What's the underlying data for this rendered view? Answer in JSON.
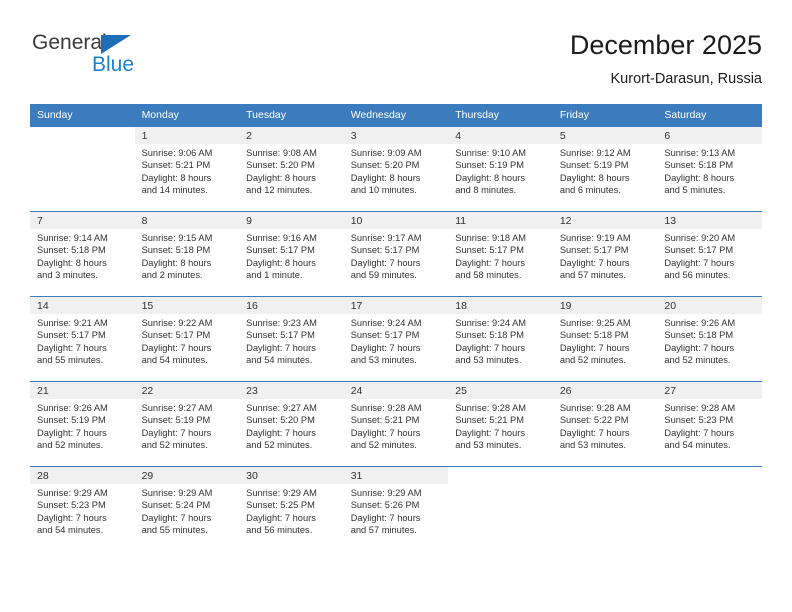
{
  "brand": {
    "name_part1": "General",
    "name_part2": "Blue",
    "triangle_color": "#1f6fb8",
    "blue_color": "#1f7fd0"
  },
  "header": {
    "title": "December 2025",
    "subtitle": "Kurort-Darasun, Russia"
  },
  "theme": {
    "header_bg": "#3b7cbf",
    "daynum_bg": "#f0f0f0",
    "row_border": "#3b7cbf"
  },
  "weekday_headers": [
    "Sunday",
    "Monday",
    "Tuesday",
    "Wednesday",
    "Thursday",
    "Friday",
    "Saturday"
  ],
  "weeks": [
    [
      {
        "day": "",
        "sunrise": "",
        "sunset": "",
        "daylight_line1": "",
        "daylight_line2": ""
      },
      {
        "day": "1",
        "sunrise": "Sunrise: 9:06 AM",
        "sunset": "Sunset: 5:21 PM",
        "daylight_line1": "Daylight: 8 hours",
        "daylight_line2": "and 14 minutes."
      },
      {
        "day": "2",
        "sunrise": "Sunrise: 9:08 AM",
        "sunset": "Sunset: 5:20 PM",
        "daylight_line1": "Daylight: 8 hours",
        "daylight_line2": "and 12 minutes."
      },
      {
        "day": "3",
        "sunrise": "Sunrise: 9:09 AM",
        "sunset": "Sunset: 5:20 PM",
        "daylight_line1": "Daylight: 8 hours",
        "daylight_line2": "and 10 minutes."
      },
      {
        "day": "4",
        "sunrise": "Sunrise: 9:10 AM",
        "sunset": "Sunset: 5:19 PM",
        "daylight_line1": "Daylight: 8 hours",
        "daylight_line2": "and 8 minutes."
      },
      {
        "day": "5",
        "sunrise": "Sunrise: 9:12 AM",
        "sunset": "Sunset: 5:19 PM",
        "daylight_line1": "Daylight: 8 hours",
        "daylight_line2": "and 6 minutes."
      },
      {
        "day": "6",
        "sunrise": "Sunrise: 9:13 AM",
        "sunset": "Sunset: 5:18 PM",
        "daylight_line1": "Daylight: 8 hours",
        "daylight_line2": "and 5 minutes."
      }
    ],
    [
      {
        "day": "7",
        "sunrise": "Sunrise: 9:14 AM",
        "sunset": "Sunset: 5:18 PM",
        "daylight_line1": "Daylight: 8 hours",
        "daylight_line2": "and 3 minutes."
      },
      {
        "day": "8",
        "sunrise": "Sunrise: 9:15 AM",
        "sunset": "Sunset: 5:18 PM",
        "daylight_line1": "Daylight: 8 hours",
        "daylight_line2": "and 2 minutes."
      },
      {
        "day": "9",
        "sunrise": "Sunrise: 9:16 AM",
        "sunset": "Sunset: 5:17 PM",
        "daylight_line1": "Daylight: 8 hours",
        "daylight_line2": "and 1 minute."
      },
      {
        "day": "10",
        "sunrise": "Sunrise: 9:17 AM",
        "sunset": "Sunset: 5:17 PM",
        "daylight_line1": "Daylight: 7 hours",
        "daylight_line2": "and 59 minutes."
      },
      {
        "day": "11",
        "sunrise": "Sunrise: 9:18 AM",
        "sunset": "Sunset: 5:17 PM",
        "daylight_line1": "Daylight: 7 hours",
        "daylight_line2": "and 58 minutes."
      },
      {
        "day": "12",
        "sunrise": "Sunrise: 9:19 AM",
        "sunset": "Sunset: 5:17 PM",
        "daylight_line1": "Daylight: 7 hours",
        "daylight_line2": "and 57 minutes."
      },
      {
        "day": "13",
        "sunrise": "Sunrise: 9:20 AM",
        "sunset": "Sunset: 5:17 PM",
        "daylight_line1": "Daylight: 7 hours",
        "daylight_line2": "and 56 minutes."
      }
    ],
    [
      {
        "day": "14",
        "sunrise": "Sunrise: 9:21 AM",
        "sunset": "Sunset: 5:17 PM",
        "daylight_line1": "Daylight: 7 hours",
        "daylight_line2": "and 55 minutes."
      },
      {
        "day": "15",
        "sunrise": "Sunrise: 9:22 AM",
        "sunset": "Sunset: 5:17 PM",
        "daylight_line1": "Daylight: 7 hours",
        "daylight_line2": "and 54 minutes."
      },
      {
        "day": "16",
        "sunrise": "Sunrise: 9:23 AM",
        "sunset": "Sunset: 5:17 PM",
        "daylight_line1": "Daylight: 7 hours",
        "daylight_line2": "and 54 minutes."
      },
      {
        "day": "17",
        "sunrise": "Sunrise: 9:24 AM",
        "sunset": "Sunset: 5:17 PM",
        "daylight_line1": "Daylight: 7 hours",
        "daylight_line2": "and 53 minutes."
      },
      {
        "day": "18",
        "sunrise": "Sunrise: 9:24 AM",
        "sunset": "Sunset: 5:18 PM",
        "daylight_line1": "Daylight: 7 hours",
        "daylight_line2": "and 53 minutes."
      },
      {
        "day": "19",
        "sunrise": "Sunrise: 9:25 AM",
        "sunset": "Sunset: 5:18 PM",
        "daylight_line1": "Daylight: 7 hours",
        "daylight_line2": "and 52 minutes."
      },
      {
        "day": "20",
        "sunrise": "Sunrise: 9:26 AM",
        "sunset": "Sunset: 5:18 PM",
        "daylight_line1": "Daylight: 7 hours",
        "daylight_line2": "and 52 minutes."
      }
    ],
    [
      {
        "day": "21",
        "sunrise": "Sunrise: 9:26 AM",
        "sunset": "Sunset: 5:19 PM",
        "daylight_line1": "Daylight: 7 hours",
        "daylight_line2": "and 52 minutes."
      },
      {
        "day": "22",
        "sunrise": "Sunrise: 9:27 AM",
        "sunset": "Sunset: 5:19 PM",
        "daylight_line1": "Daylight: 7 hours",
        "daylight_line2": "and 52 minutes."
      },
      {
        "day": "23",
        "sunrise": "Sunrise: 9:27 AM",
        "sunset": "Sunset: 5:20 PM",
        "daylight_line1": "Daylight: 7 hours",
        "daylight_line2": "and 52 minutes."
      },
      {
        "day": "24",
        "sunrise": "Sunrise: 9:28 AM",
        "sunset": "Sunset: 5:21 PM",
        "daylight_line1": "Daylight: 7 hours",
        "daylight_line2": "and 52 minutes."
      },
      {
        "day": "25",
        "sunrise": "Sunrise: 9:28 AM",
        "sunset": "Sunset: 5:21 PM",
        "daylight_line1": "Daylight: 7 hours",
        "daylight_line2": "and 53 minutes."
      },
      {
        "day": "26",
        "sunrise": "Sunrise: 9:28 AM",
        "sunset": "Sunset: 5:22 PM",
        "daylight_line1": "Daylight: 7 hours",
        "daylight_line2": "and 53 minutes."
      },
      {
        "day": "27",
        "sunrise": "Sunrise: 9:28 AM",
        "sunset": "Sunset: 5:23 PM",
        "daylight_line1": "Daylight: 7 hours",
        "daylight_line2": "and 54 minutes."
      }
    ],
    [
      {
        "day": "28",
        "sunrise": "Sunrise: 9:29 AM",
        "sunset": "Sunset: 5:23 PM",
        "daylight_line1": "Daylight: 7 hours",
        "daylight_line2": "and 54 minutes."
      },
      {
        "day": "29",
        "sunrise": "Sunrise: 9:29 AM",
        "sunset": "Sunset: 5:24 PM",
        "daylight_line1": "Daylight: 7 hours",
        "daylight_line2": "and 55 minutes."
      },
      {
        "day": "30",
        "sunrise": "Sunrise: 9:29 AM",
        "sunset": "Sunset: 5:25 PM",
        "daylight_line1": "Daylight: 7 hours",
        "daylight_line2": "and 56 minutes."
      },
      {
        "day": "31",
        "sunrise": "Sunrise: 9:29 AM",
        "sunset": "Sunset: 5:26 PM",
        "daylight_line1": "Daylight: 7 hours",
        "daylight_line2": "and 57 minutes."
      },
      {
        "day": "",
        "sunrise": "",
        "sunset": "",
        "daylight_line1": "",
        "daylight_line2": ""
      },
      {
        "day": "",
        "sunrise": "",
        "sunset": "",
        "daylight_line1": "",
        "daylight_line2": ""
      },
      {
        "day": "",
        "sunrise": "",
        "sunset": "",
        "daylight_line1": "",
        "daylight_line2": ""
      }
    ]
  ]
}
